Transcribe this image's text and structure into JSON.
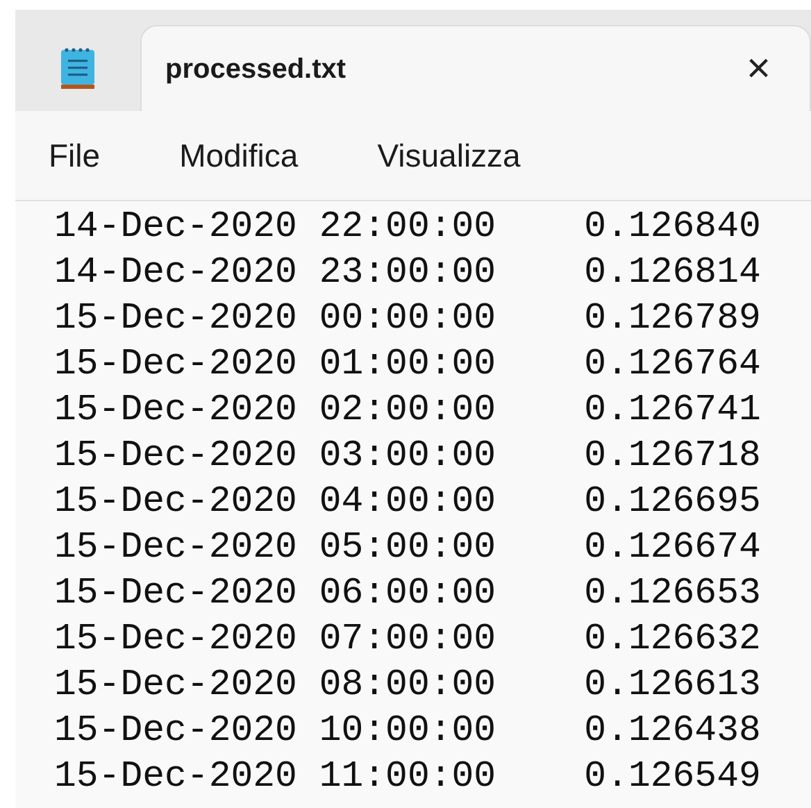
{
  "tab": {
    "title": "processed.txt",
    "close": "×"
  },
  "menu": [
    "File",
    "Modifica",
    "Visualizza"
  ],
  "lines": [
    "14-Dec-2020 22:00:00    0.126840",
    "14-Dec-2020 23:00:00    0.126814",
    "15-Dec-2020 00:00:00    0.126789",
    "15-Dec-2020 01:00:00    0.126764",
    "15-Dec-2020 02:00:00    0.126741",
    "15-Dec-2020 03:00:00    0.126718",
    "15-Dec-2020 04:00:00    0.126695",
    "15-Dec-2020 05:00:00    0.126674",
    "15-Dec-2020 06:00:00    0.126653",
    "15-Dec-2020 07:00:00    0.126632",
    "15-Dec-2020 08:00:00    0.126613",
    "15-Dec-2020 10:00:00    0.126438",
    "15-Dec-2020 11:00:00    0.126549"
  ]
}
